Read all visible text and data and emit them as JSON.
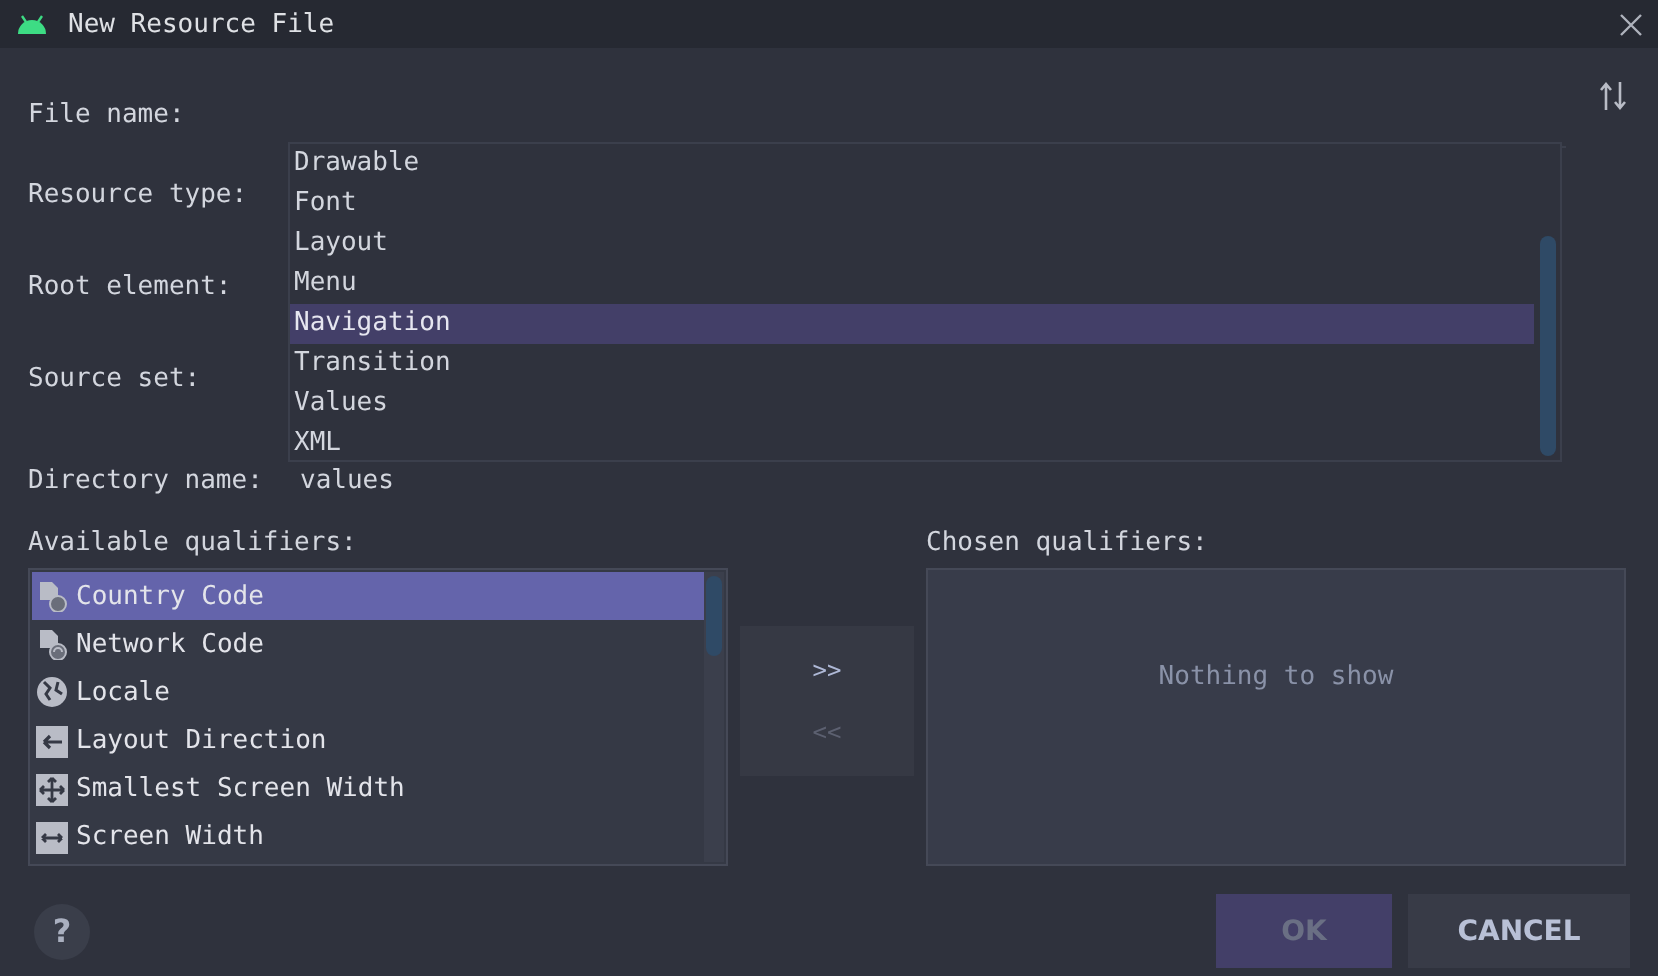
{
  "window": {
    "title": "New Resource File"
  },
  "form": {
    "fields": [
      {
        "label": "File name:"
      },
      {
        "label": "Resource type:"
      },
      {
        "label": "Root element:"
      },
      {
        "label": "Source set:"
      },
      {
        "label": "Directory name:",
        "value": "values"
      }
    ]
  },
  "resource_type_popup": {
    "items": [
      {
        "label": "Drawable",
        "selected": false
      },
      {
        "label": "Font",
        "selected": false
      },
      {
        "label": "Layout",
        "selected": false
      },
      {
        "label": "Menu",
        "selected": false
      },
      {
        "label": "Navigation",
        "selected": true
      },
      {
        "label": "Transition",
        "selected": false
      },
      {
        "label": "Values",
        "selected": false
      },
      {
        "label": "XML",
        "selected": false
      }
    ]
  },
  "available_qualifiers": {
    "label": "Available qualifiers:",
    "items": [
      {
        "label": "Country Code",
        "kind": "country",
        "selected": true
      },
      {
        "label": "Network Code",
        "kind": "network",
        "selected": false
      },
      {
        "label": "Locale",
        "kind": "locale",
        "selected": false
      },
      {
        "label": "Layout Direction",
        "kind": "direction",
        "selected": false
      },
      {
        "label": "Smallest Screen Width",
        "kind": "smallest",
        "selected": false
      },
      {
        "label": "Screen Width",
        "kind": "width",
        "selected": false
      }
    ]
  },
  "move_buttons": [
    {
      "label": ">>",
      "disabled": false
    },
    {
      "label": "<<",
      "disabled": true
    }
  ],
  "chosen_qualifiers": {
    "label": "Chosen qualifiers:",
    "empty_text": "Nothing to show"
  },
  "footer": {
    "help": "?",
    "buttons": [
      {
        "label": "OK",
        "kind": "primary",
        "disabled": true
      },
      {
        "label": "CANCEL",
        "kind": "secondary",
        "disabled": false
      }
    ]
  }
}
